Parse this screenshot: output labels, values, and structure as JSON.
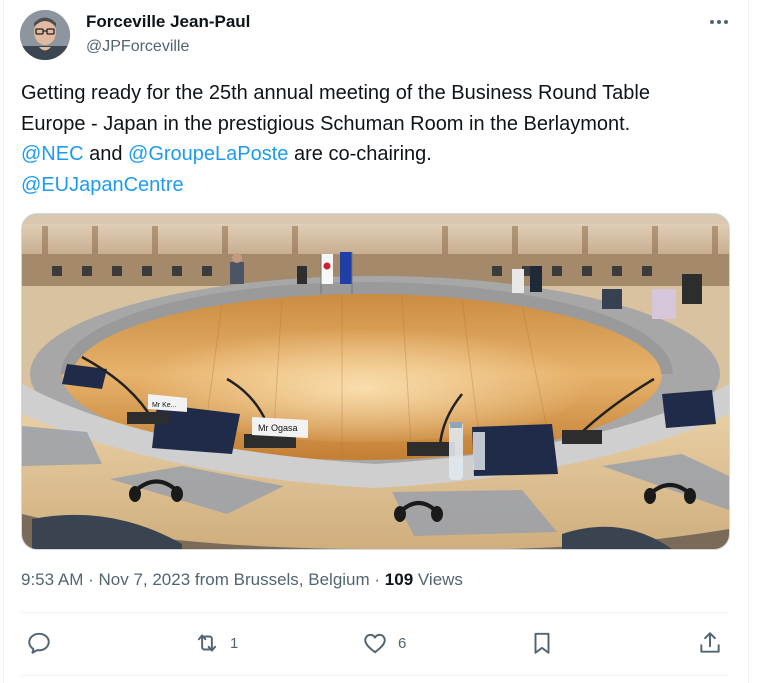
{
  "author": {
    "name": "Forceville Jean-Paul",
    "handle": "@JPForceville"
  },
  "tweet": {
    "line1": "Getting ready for the 25th annual meeting of the Business Round Table",
    "line2": "Europe - Japan in the prestigious Schuman Room in the Berlaymont.",
    "mention_nec": "@NEC",
    "and_text": " and ",
    "mention_laposte": "@GroupeLaPoste",
    "cochair_text": " are co-chairing.",
    "mention_eujc": "@EUJapanCentre"
  },
  "media": {
    "nameplate_1": "Mr Ogasa",
    "nameplate_2": "Mr Ke..."
  },
  "meta": {
    "time": "9:53 AM",
    "sep1": " · ",
    "date": "Nov 7, 2023",
    "from": " from Brussels, Belgium",
    "sep2": " · ",
    "views_count": "109",
    "views_label": " Views"
  },
  "actions": {
    "reply_count": "",
    "retweet_count": "1",
    "like_count": "6"
  },
  "icons": {
    "more": "more-icon",
    "reply": "reply-icon",
    "retweet": "retweet-icon",
    "like": "heart-icon",
    "bookmark": "bookmark-icon",
    "share": "share-icon"
  },
  "colors": {
    "accent": "#1d9bf0",
    "secondary_text": "#536471",
    "primary_text": "#0f1419"
  }
}
